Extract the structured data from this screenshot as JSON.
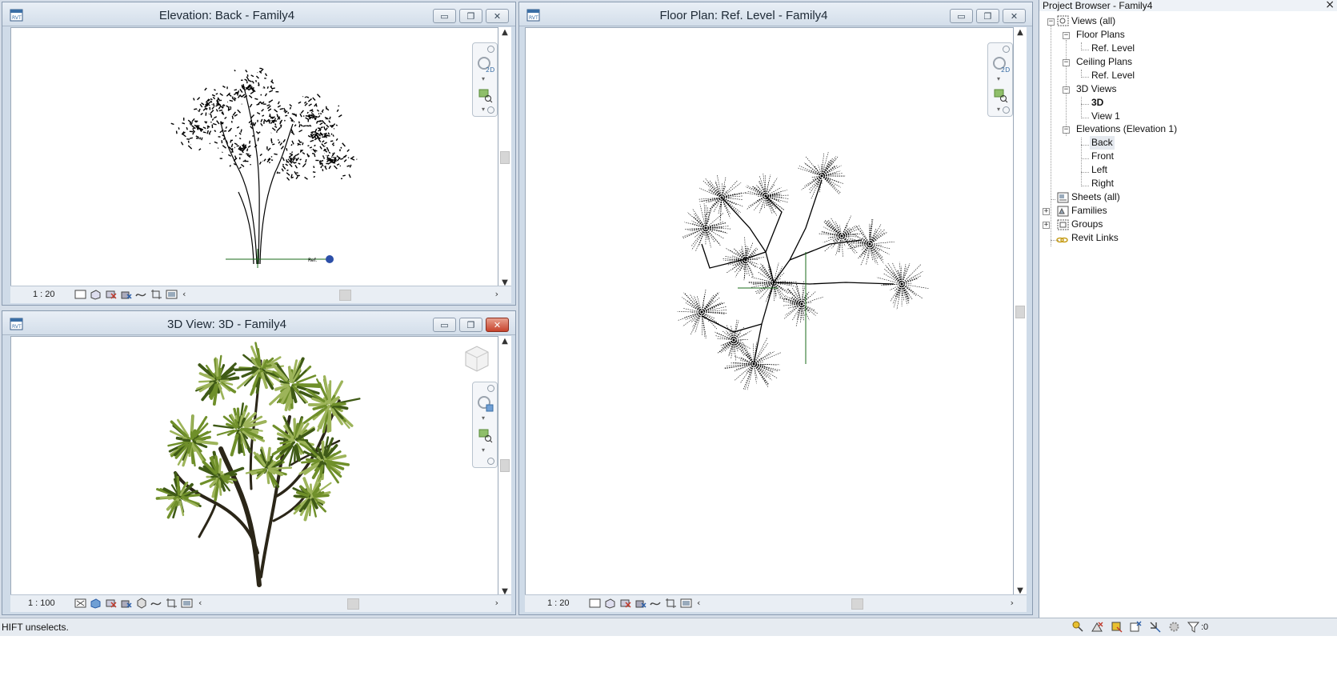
{
  "views": {
    "elevation": {
      "title": "Elevation: Back - Family4",
      "scale": "1 : 20"
    },
    "floor_plan": {
      "title": "Floor Plan: Ref. Level - Family4",
      "scale": "1 : 20"
    },
    "view_3d": {
      "title": "3D View: 3D - Family4",
      "scale": "1 : 100"
    }
  },
  "project_browser": {
    "title": "Project Browser - Family4",
    "close_glyph": "×",
    "tree": {
      "views_all": "Views (all)",
      "floor_plans": "Floor Plans",
      "floor_plans_ref_level": "Ref. Level",
      "ceiling_plans": "Ceiling Plans",
      "ceiling_plans_ref_level": "Ref. Level",
      "views_3d": "3D Views",
      "view_3d_item": "3D",
      "view_1": "View 1",
      "elevations": "Elevations (Elevation 1)",
      "back": "Back",
      "front": "Front",
      "left": "Left",
      "right": "Right",
      "sheets_all": "Sheets (all)",
      "families": "Families",
      "groups": "Groups",
      "revit_links": "Revit Links"
    }
  },
  "statusbar": {
    "message": "HIFT unselects.",
    "filter_count": ":0"
  },
  "glyphs": {
    "minimize": "▭",
    "restore": "❐",
    "close": "✕",
    "scroll_up": "▲",
    "scroll_down": "▼",
    "scroll_left": "‹",
    "scroll_right": "›",
    "nav_drop": "▾",
    "plus": "+",
    "minus": "−"
  },
  "colors": {
    "title_gradient_top": "#e9eff6",
    "close_button_red": "#c7432c",
    "foliage_green": "#6f8f2a",
    "trunk_dark": "#2b2618"
  }
}
